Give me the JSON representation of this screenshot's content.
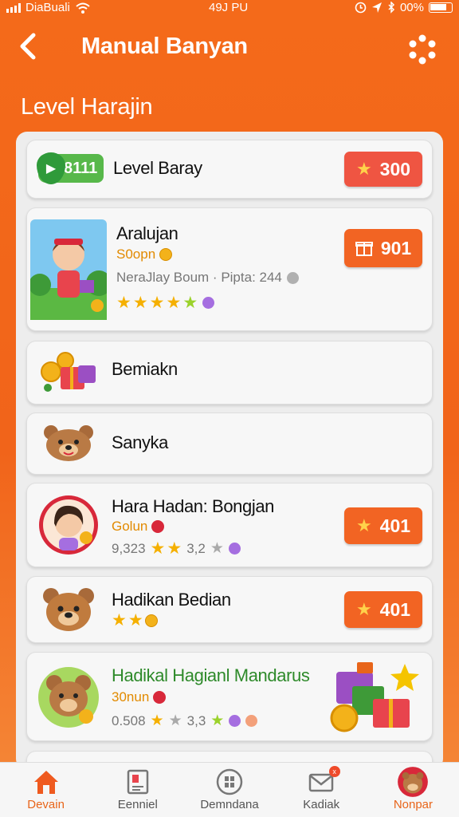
{
  "status_bar": {
    "carrier": "DiaBuali",
    "time": "49J PU",
    "battery": "00%"
  },
  "header": {
    "back_icon": "chevron-left-icon",
    "title": "Manual Banyan",
    "settings_icon": "settings-dots-icon"
  },
  "section": {
    "title": "Level Harajin"
  },
  "cards": [
    {
      "name": "Level Baray",
      "tag": "8111",
      "button": "300",
      "button_icon": "star-icon"
    },
    {
      "name": "Aralujan",
      "sub": "S0opn",
      "meta": "NeraJlay Boum · Pipta: 244",
      "rating": 5,
      "button": "901",
      "button_icon": "gift-icon"
    },
    {
      "name": "Bemiakn"
    },
    {
      "name": "Sanyka"
    },
    {
      "name": "Hara Hadan: Bongjan",
      "sub": "Golun",
      "meta_left": "9,323",
      "meta_right": "3,2",
      "rating": 2,
      "button": "401",
      "button_icon": "star-icon"
    },
    {
      "name": "Hadikan Bedian",
      "rating": 2,
      "button": "401",
      "button_icon": "star-icon"
    },
    {
      "name": "Hadikal Hagianl Mandarus",
      "sub": "30nun",
      "meta_left": "0.508",
      "meta_right": "3,3",
      "rating": 1
    }
  ],
  "nav": {
    "items": [
      {
        "label": "Devain",
        "icon": "home-icon",
        "active": true
      },
      {
        "label": "Eenniel",
        "icon": "document-icon",
        "active": false
      },
      {
        "label": "Demndana",
        "icon": "grid-icon",
        "active": false
      },
      {
        "label": "Kadiak",
        "icon": "mail-icon",
        "active": false,
        "badge": "x"
      },
      {
        "label": "Nonpar",
        "icon": "avatar-icon",
        "active": false
      }
    ]
  },
  "colors": {
    "brand_orange": "#f46a1a",
    "button_orange": "#f26423",
    "star_yellow": "#f5b000",
    "green_tag": "#57b84a"
  }
}
